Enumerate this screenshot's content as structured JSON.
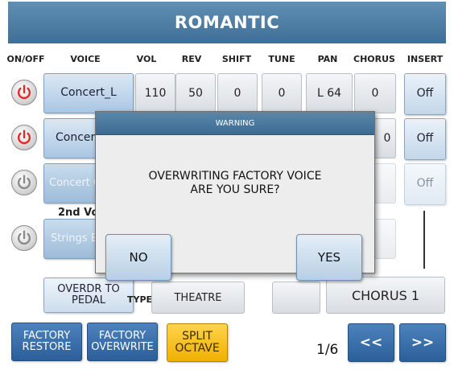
{
  "title": "ROMANTIC",
  "headers": [
    "ON/OFF",
    "VOICE",
    "VOL",
    "REV",
    "SHIFT",
    "TUNE",
    "PAN",
    "CHORUS",
    "INSERT"
  ],
  "rows": [
    {
      "voice": "Concert_L",
      "vol": "110",
      "rev": "50",
      "shift": "0",
      "tune": "0",
      "pan": "L 64",
      "chorus": "0",
      "insert": "Off"
    },
    {
      "voice": "Concert",
      "chorus": "0",
      "insert": "Off"
    },
    {
      "voice": "Concert G",
      "insert": "Off"
    },
    {
      "voice": "Strings E"
    }
  ],
  "second_voice_label": "2nd Vo",
  "effects": {
    "overdrive_label": "OVERDR TO PEDAL",
    "type_label": "TYPE",
    "type_value": "THEATRE",
    "chorus_value": "CHORUS 1"
  },
  "bottom": {
    "factory_restore": "FACTORY RESTORE",
    "factory_overwrite": "FACTORY OVERWRITE",
    "split_octave": "SPLIT OCTAVE",
    "page": "1/6",
    "prev": "<<",
    "next": ">>"
  },
  "dialog": {
    "title": "WARNING",
    "line1": "OVERWRITING FACTORY VOICE",
    "line2": "ARE YOU SURE?",
    "no": "NO",
    "yes": "YES"
  },
  "colors": {
    "power_on": "#e02a2a",
    "power_off": "#8a8a8a",
    "title_bar": "#4a7aa2",
    "split_button": "#f5c21a"
  }
}
